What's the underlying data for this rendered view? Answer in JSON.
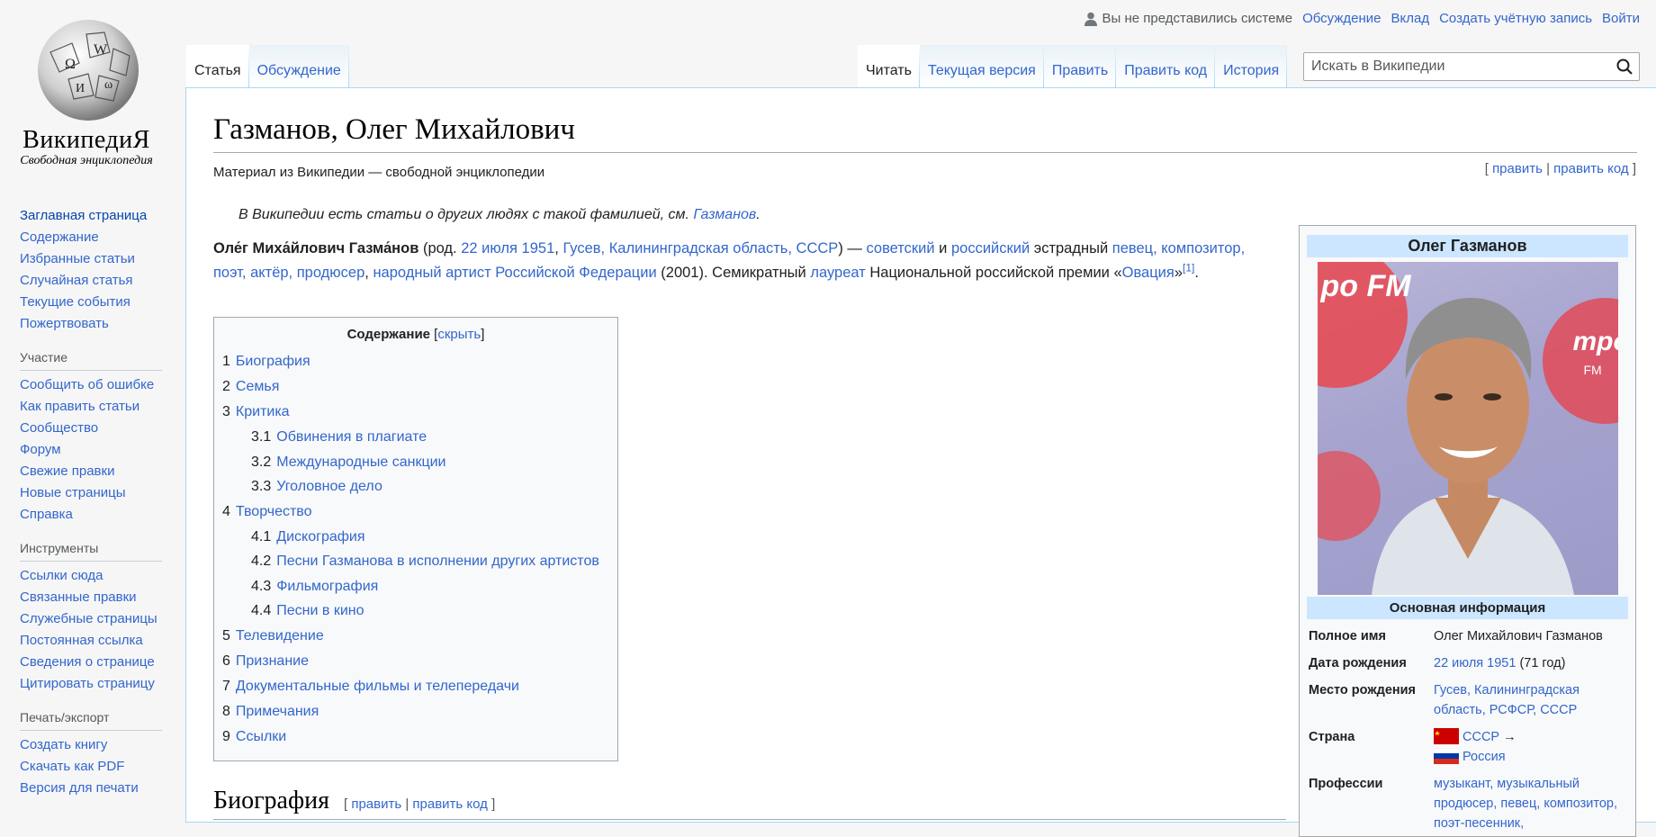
{
  "personal": {
    "status": "Вы не представились системе",
    "talk": "Обсуждение",
    "contributions": "Вклад",
    "create_account": "Создать учётную запись",
    "login": "Войти"
  },
  "logo": {
    "wordmark": "ВикипедиЯ",
    "tagline": "Свободная энциклопедия"
  },
  "sidebar": {
    "nav": [
      "Заглавная страница",
      "Содержание",
      "Избранные статьи",
      "Случайная статья",
      "Текущие события",
      "Пожертвовать"
    ],
    "participation_heading": "Участие",
    "participation": [
      "Сообщить об ошибке",
      "Как править статьи",
      "Сообщество",
      "Форум",
      "Свежие правки",
      "Новые страницы",
      "Справка"
    ],
    "tools_heading": "Инструменты",
    "tools": [
      "Ссылки сюда",
      "Связанные правки",
      "Служебные страницы",
      "Постоянная ссылка",
      "Сведения о странице",
      "Цитировать страницу"
    ],
    "print_heading": "Печать/экспорт",
    "print": [
      "Создать книгу",
      "Скачать как PDF",
      "Версия для печати"
    ]
  },
  "tabs": {
    "left": [
      "Статья",
      "Обсуждение"
    ],
    "right": [
      "Читать",
      "Текущая версия",
      "Править",
      "Править код",
      "История"
    ]
  },
  "search": {
    "placeholder": "Искать в Википедии"
  },
  "article": {
    "title": "Газманов, Олег Михайлович",
    "site_sub": "Материал из Википедии — свободной энциклопедии",
    "edit": "править",
    "edit_source": "править код",
    "hatnote_text": "В Википедии есть статьи о других людях с такой фамилией, см. ",
    "hatnote_link": "Газманов",
    "lead": {
      "name": "Оле́г Миха́йлович Газма́нов",
      "t1": " (род. ",
      "birth_date": "22 июля 1951",
      "t2": ", ",
      "birth_place": "Гусев, Калининградская область, СССР",
      "t3": ") — ",
      "soviet": "советский",
      "t4": " и ",
      "russian": "российский",
      "t5": " эстрадный ",
      "roles": "певец, композитор, поэт, актёр, продюсер",
      "t6": ", ",
      "title_link": "народный артист Российской Федерации",
      "t7": " (2001). Семикратный ",
      "laureate": "лауреат",
      "t8": " Национальной российской премии «",
      "award": "Овация",
      "t9": "»",
      "ref": "[1]",
      "t10": "."
    },
    "toc": {
      "title": "Содержание",
      "hide": "скрыть",
      "items": [
        {
          "num": "1",
          "text": "Биография",
          "level": 1
        },
        {
          "num": "2",
          "text": "Семья",
          "level": 1
        },
        {
          "num": "3",
          "text": "Критика",
          "level": 1
        },
        {
          "num": "3.1",
          "text": "Обвинения в плагиате",
          "level": 2
        },
        {
          "num": "3.2",
          "text": "Международные санкции",
          "level": 2
        },
        {
          "num": "3.3",
          "text": "Уголовное дело",
          "level": 2
        },
        {
          "num": "4",
          "text": "Творчество",
          "level": 1
        },
        {
          "num": "4.1",
          "text": "Дискография",
          "level": 2
        },
        {
          "num": "4.2",
          "text": "Песни Газманова в исполнении других артистов",
          "level": 2
        },
        {
          "num": "4.3",
          "text": "Фильмография",
          "level": 2
        },
        {
          "num": "4.4",
          "text": "Песни в кино",
          "level": 2
        },
        {
          "num": "5",
          "text": "Телевидение",
          "level": 1
        },
        {
          "num": "6",
          "text": "Признание",
          "level": 1
        },
        {
          "num": "7",
          "text": "Документальные фильмы и телепередачи",
          "level": 1
        },
        {
          "num": "8",
          "text": "Примечания",
          "level": 1
        },
        {
          "num": "9",
          "text": "Ссылки",
          "level": 1
        }
      ]
    },
    "section_biography": "Биография"
  },
  "infobox": {
    "title": "Олег Газманов",
    "photo_text_left": "ро FM",
    "photo_text_right": "тро",
    "photo_text_right2": "FM",
    "subheader": "Основная информация",
    "full_name_label": "Полное имя",
    "full_name": "Олег Михайлович Газманов",
    "birth_label": "Дата рождения",
    "birth_date": "22 июля 1951",
    "birth_age": " (71 год)",
    "place_label": "Место рождения",
    "place": "Гусев, Калининградская область, РСФСР, СССР",
    "country_label": "Страна",
    "country_1": "СССР",
    "country_arrow": " →",
    "country_2": "Россия",
    "professions_label": "Профессии",
    "professions": "музыкант, музыкальный продюсер, певец, композитор, поэт-песенник,"
  },
  "colors": {
    "link": "#3366cc",
    "border": "#a7d7f9",
    "infobox_header": "#cce6ff"
  }
}
